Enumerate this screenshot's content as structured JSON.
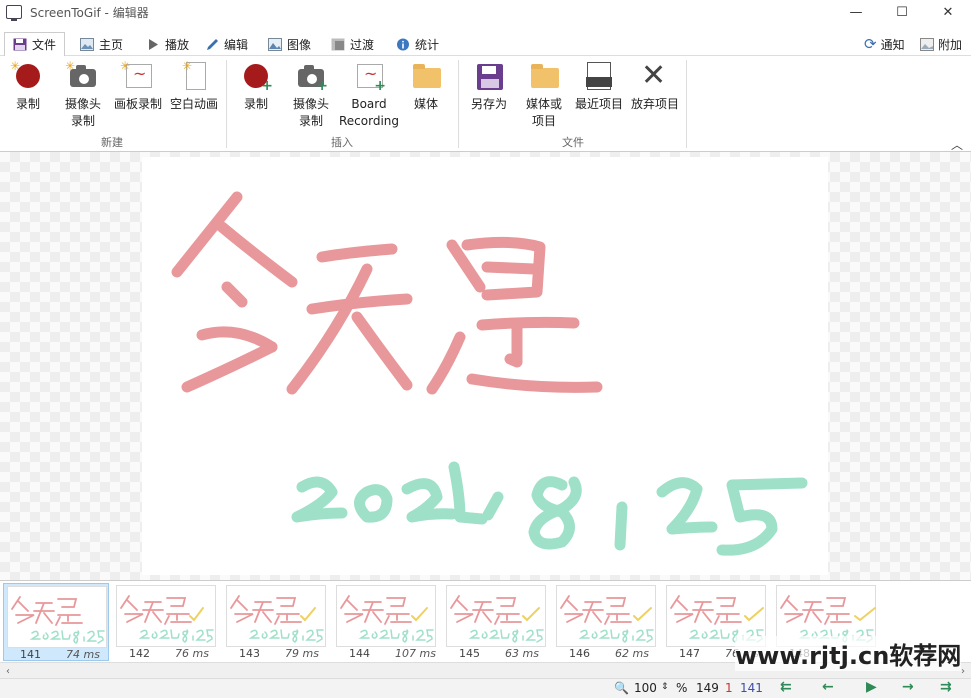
{
  "window": {
    "title": "ScreenToGif - 编辑器",
    "minimize": "—",
    "maximize": "☐",
    "close": "✕"
  },
  "tabs": [
    {
      "label": "文件",
      "icon": "floppy-icon"
    },
    {
      "label": "主页",
      "icon": "image-icon"
    },
    {
      "label": "播放",
      "icon": "play-icon"
    },
    {
      "label": "编辑",
      "icon": "pencil-icon"
    },
    {
      "label": "图像",
      "icon": "picture-icon"
    },
    {
      "label": "过渡",
      "icon": "transition-icon"
    },
    {
      "label": "统计",
      "icon": "info-icon"
    }
  ],
  "tab_right": {
    "notify_label": "通知",
    "attach_label": "附加"
  },
  "ribbon": {
    "groups": {
      "new": "新建",
      "insert": "插入",
      "file": "文件"
    },
    "new": {
      "record": "录制",
      "webcam": [
        "摄像头",
        "录制"
      ],
      "board": "画板录制",
      "blank": "空白动画"
    },
    "insert": {
      "record": "录制",
      "webcam": [
        "摄像头",
        "录制"
      ],
      "board": [
        "Board",
        "Recording"
      ],
      "media": "媒体"
    },
    "file": {
      "save_as": "另存为",
      "media_or_project": [
        "媒体或",
        "项目"
      ],
      "recent": "最近项目",
      "discard": "放弃项目"
    }
  },
  "canvas": {
    "handwriting_line1": "今天是",
    "handwriting_line2": "2021.8.25",
    "colors": {
      "line1": "#e8979a",
      "line2": "#9fe0c8"
    }
  },
  "filmstrip": {
    "frames": [
      {
        "number": "141",
        "duration": "74 ms",
        "selected": true
      },
      {
        "number": "142",
        "duration": "76 ms",
        "selected": false
      },
      {
        "number": "143",
        "duration": "79 ms",
        "selected": false
      },
      {
        "number": "144",
        "duration": "107 ms",
        "selected": false
      },
      {
        "number": "145",
        "duration": "63 ms",
        "selected": false
      },
      {
        "number": "146",
        "duration": "62 ms",
        "selected": false
      },
      {
        "number": "147",
        "duration": "76 ms",
        "selected": false
      },
      {
        "number": "148",
        "duration": "",
        "selected": false
      }
    ]
  },
  "statusbar": {
    "zoom_value": "100",
    "zoom_unit": "%",
    "total_frames": "149",
    "selected_count": "1",
    "current_frame": "141"
  },
  "watermark": "www.rjtj.cn软荐网"
}
